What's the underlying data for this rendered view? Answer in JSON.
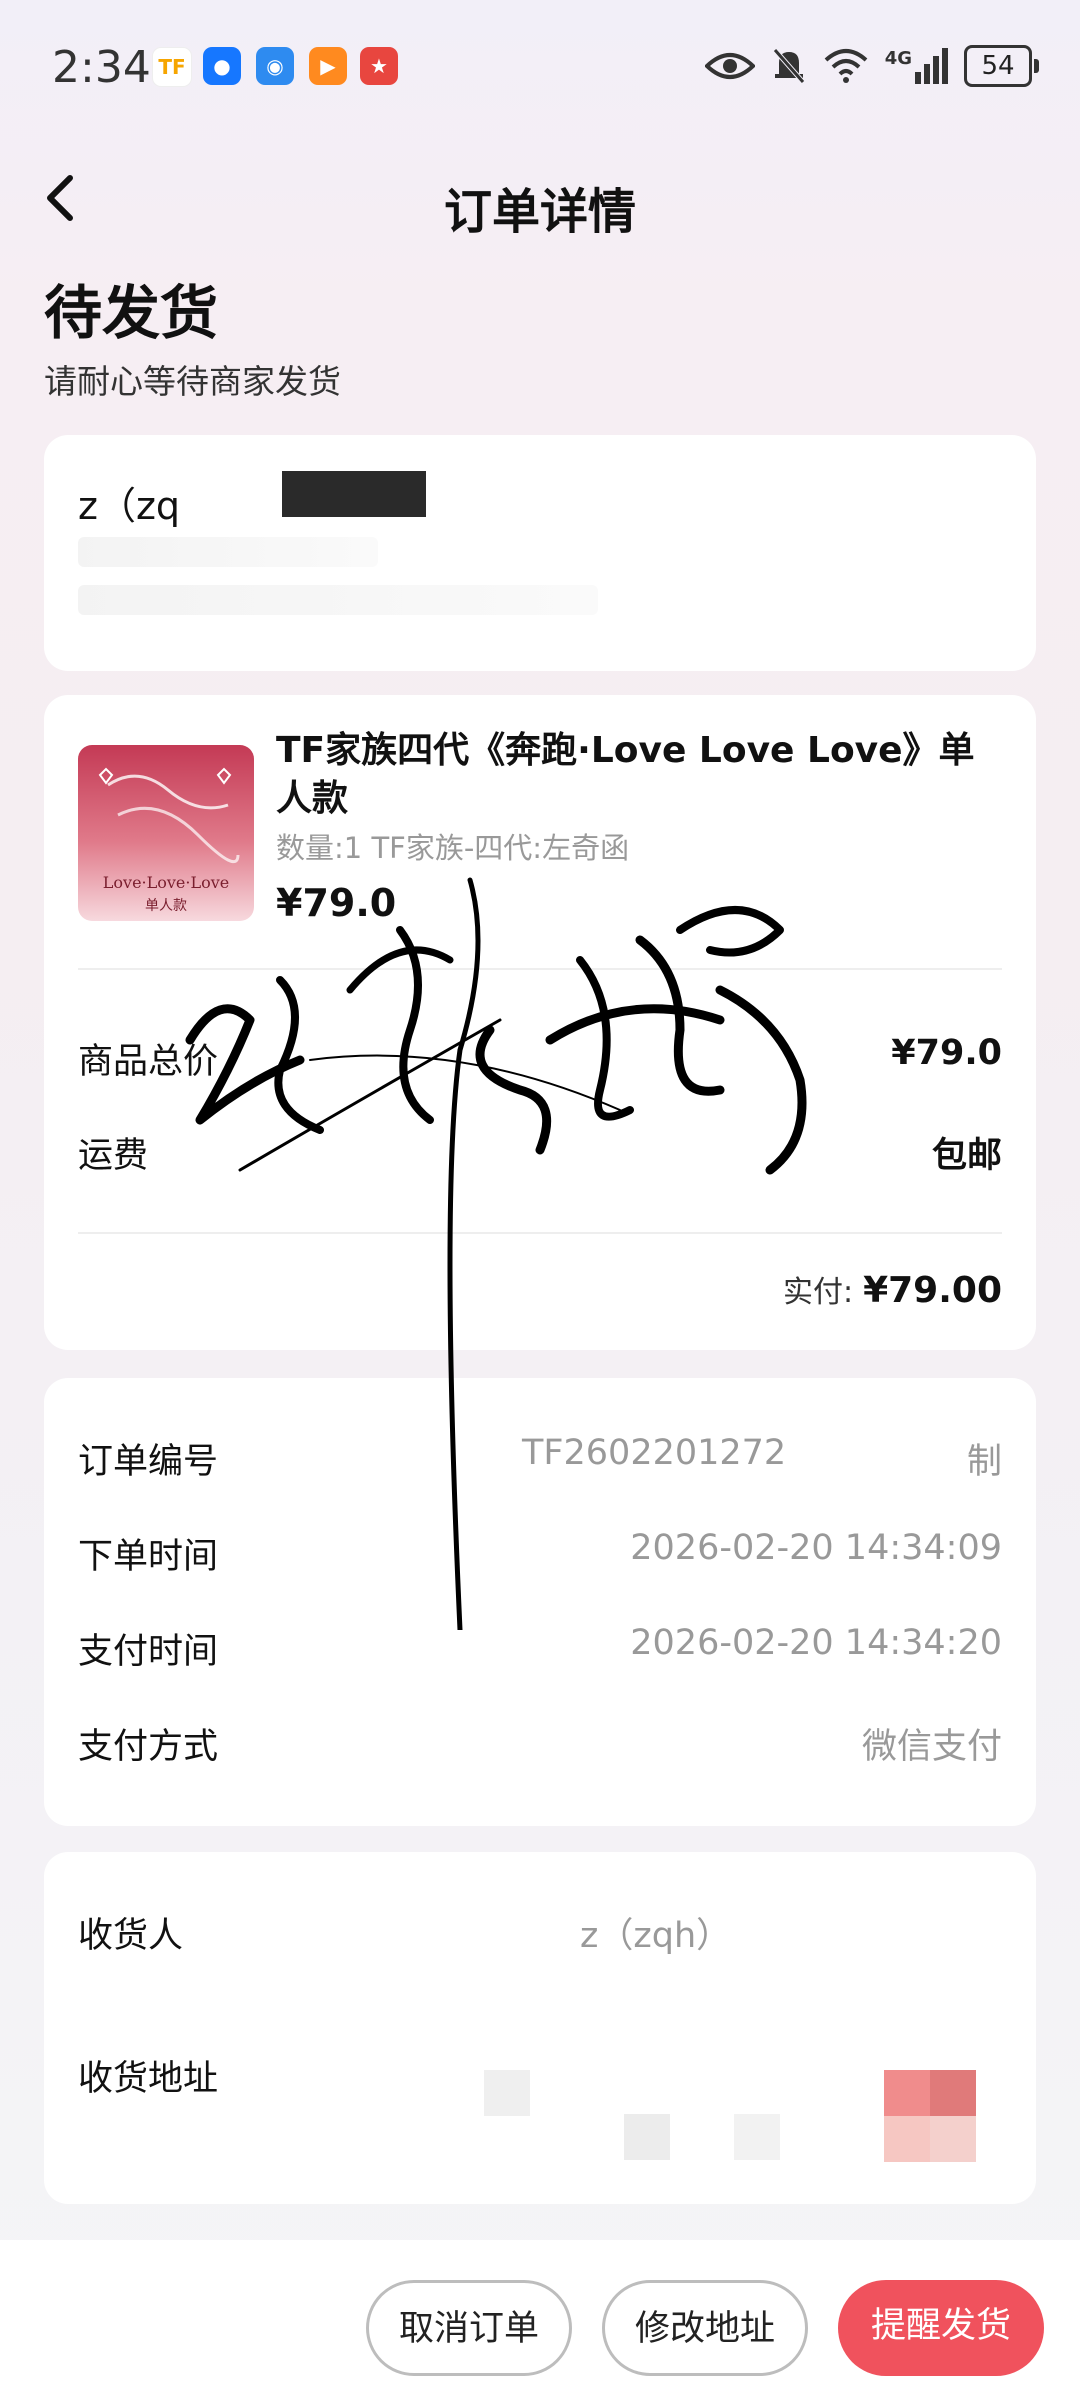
{
  "status_bar": {
    "time": "2:34",
    "battery": "54",
    "network": "4G",
    "app_icons": [
      {
        "name": "tf-app-icon",
        "color": "#f6c02a"
      },
      {
        "name": "bulb-app-icon",
        "color": "#1677ff"
      },
      {
        "name": "wifi-app-icon",
        "color": "#2e8bf0"
      },
      {
        "name": "video-app-icon",
        "color": "#ff8a1f"
      },
      {
        "name": "game-app-icon",
        "color": "#e8463f"
      }
    ]
  },
  "header": {
    "title": "订单详情"
  },
  "order_status": {
    "title": "待发货",
    "subtitle": "请耐心等待商家发货"
  },
  "address_card": {
    "name_prefix": "z（zq"
  },
  "product": {
    "title": "TF家族四代《奔跑·Love Love Love》单人款",
    "spec": "数量:1 TF家族-四代:左奇函",
    "price": "¥79.0",
    "image_caption": "Love·Love·Love",
    "image_subcaption": "单人款"
  },
  "price_summary": {
    "subtotal_label": "商品总价",
    "subtotal_value": "¥79.0",
    "shipping_label": "运费",
    "shipping_value": "包邮",
    "paid_label": "实付:",
    "paid_value": "¥79.00"
  },
  "order_info": {
    "number_label": "订单编号",
    "number_value": "TF2602201272",
    "number_action": "制",
    "created_label": "下单时间",
    "created_value": "2026-02-20 14:34:09",
    "paid_time_label": "支付时间",
    "paid_time_value": "2026-02-20 14:34:20",
    "method_label": "支付方式",
    "method_value": "微信支付"
  },
  "receiver": {
    "name_label": "收货人",
    "name_value": "z（zqh）",
    "address_label": "收货地址"
  },
  "actions": {
    "cancel": "取消订单",
    "modify": "修改地址",
    "remind": "提醒发货"
  },
  "colors": {
    "accent": "#f0525d"
  }
}
